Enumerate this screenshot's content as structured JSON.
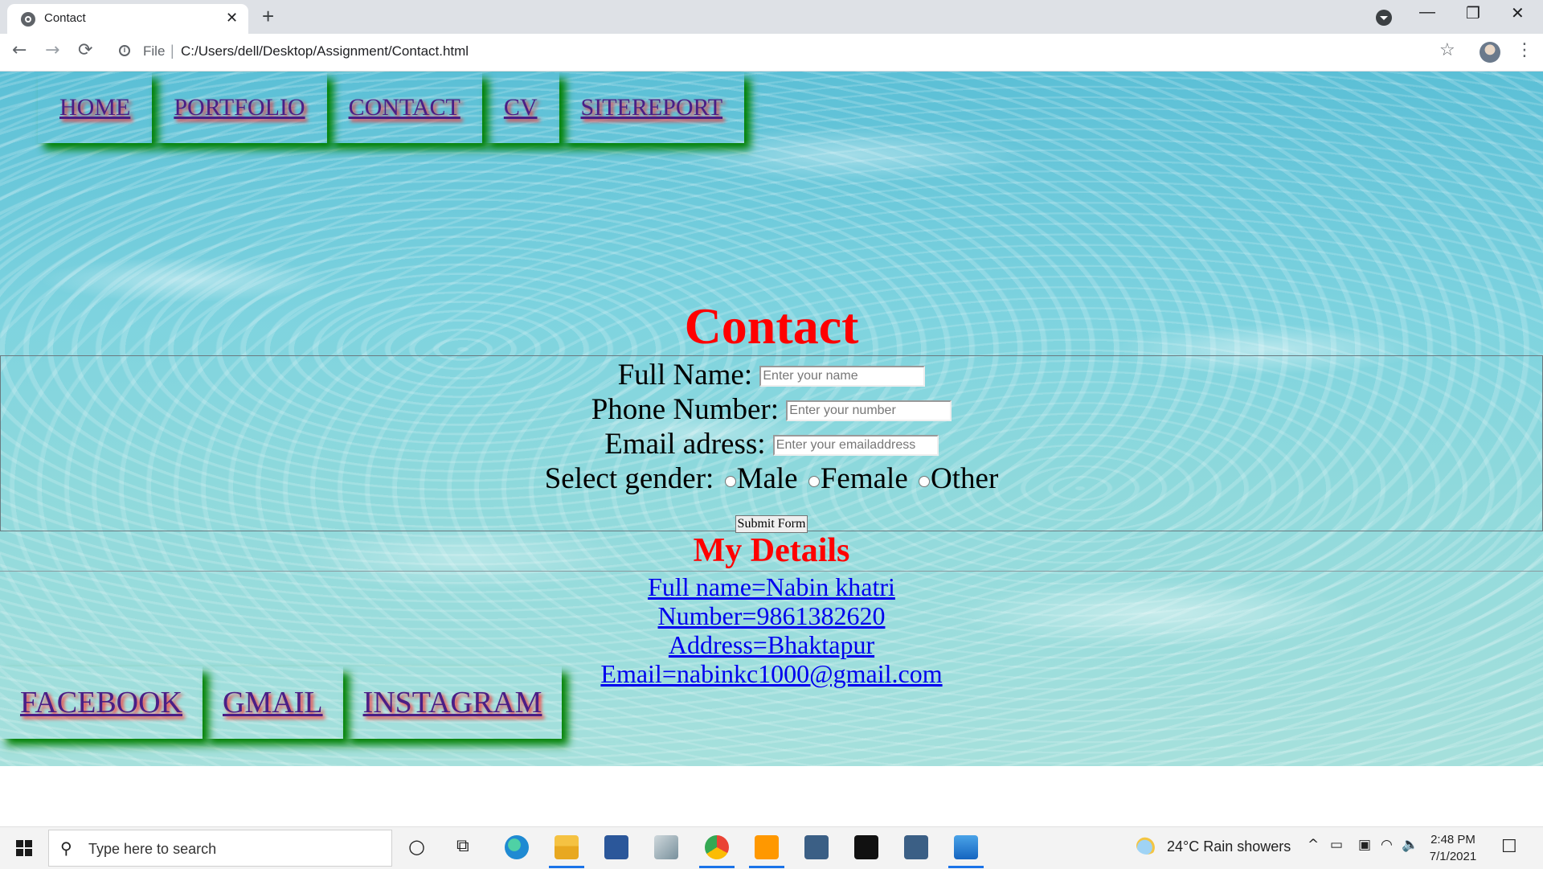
{
  "browser": {
    "tab_title": "Contact",
    "tab_close": "✕",
    "new_tab": "+",
    "minimize": "—",
    "restore": "❐",
    "close": "✕",
    "back": "←",
    "forward": "→",
    "reload": "⟳",
    "info": "i",
    "file_label": "File",
    "url_separator": "|",
    "url": "C:/Users/dell/Desktop/Assignment/Contact.html",
    "star": "☆",
    "menu": "⋮"
  },
  "nav": {
    "items": [
      "HOME",
      "PORTFOLIO",
      "CONTACT",
      "CV",
      "SITEREPORT"
    ]
  },
  "page": {
    "heading": "Contact",
    "form": {
      "name_label": "Full Name:",
      "name_placeholder": "Enter your name",
      "phone_label": "Phone Number:",
      "phone_placeholder": "Enter your number",
      "email_label": "Email adress:",
      "email_placeholder": "Enter your emailaddress",
      "gender_label": "Select gender:",
      "gender_options": [
        "Male",
        "Female",
        "Other"
      ],
      "submit_label": "Submit Form"
    },
    "details_heading": "My Details",
    "details": [
      "Full name=Nabin khatri",
      "Number=9861382620",
      "Address=Bhaktapur",
      "Email=nabinkc1000@gmail.com"
    ]
  },
  "footer_nav": {
    "items": [
      "FACEBOOK",
      "GMAIL",
      "INSTAGRAM"
    ]
  },
  "taskbar": {
    "search_icon": "⚲",
    "search_placeholder": "Type here to search",
    "cortana": "○",
    "task_view": "⧉",
    "apps": [
      "edge-icon",
      "file-explorer-icon",
      "word-icon",
      "app-icon",
      "chrome-icon",
      "sublime-icon",
      "mysql-workbench-icon",
      "mysql-icon",
      "workbench-icon",
      "photos-icon"
    ],
    "weather_text": "24°C  Rain showers",
    "tray_chevron": "^",
    "tray_battery": "▭",
    "tray_network": "◠",
    "tray_volume": "🔈",
    "time": "2:48 PM",
    "date": "7/1/2021",
    "notification": "☐"
  },
  "colors": {
    "heading_red": "#ff0000",
    "nav_text": "#4a1e86",
    "nav_glow_green": "#008000",
    "link_blue": "#0000ee"
  }
}
